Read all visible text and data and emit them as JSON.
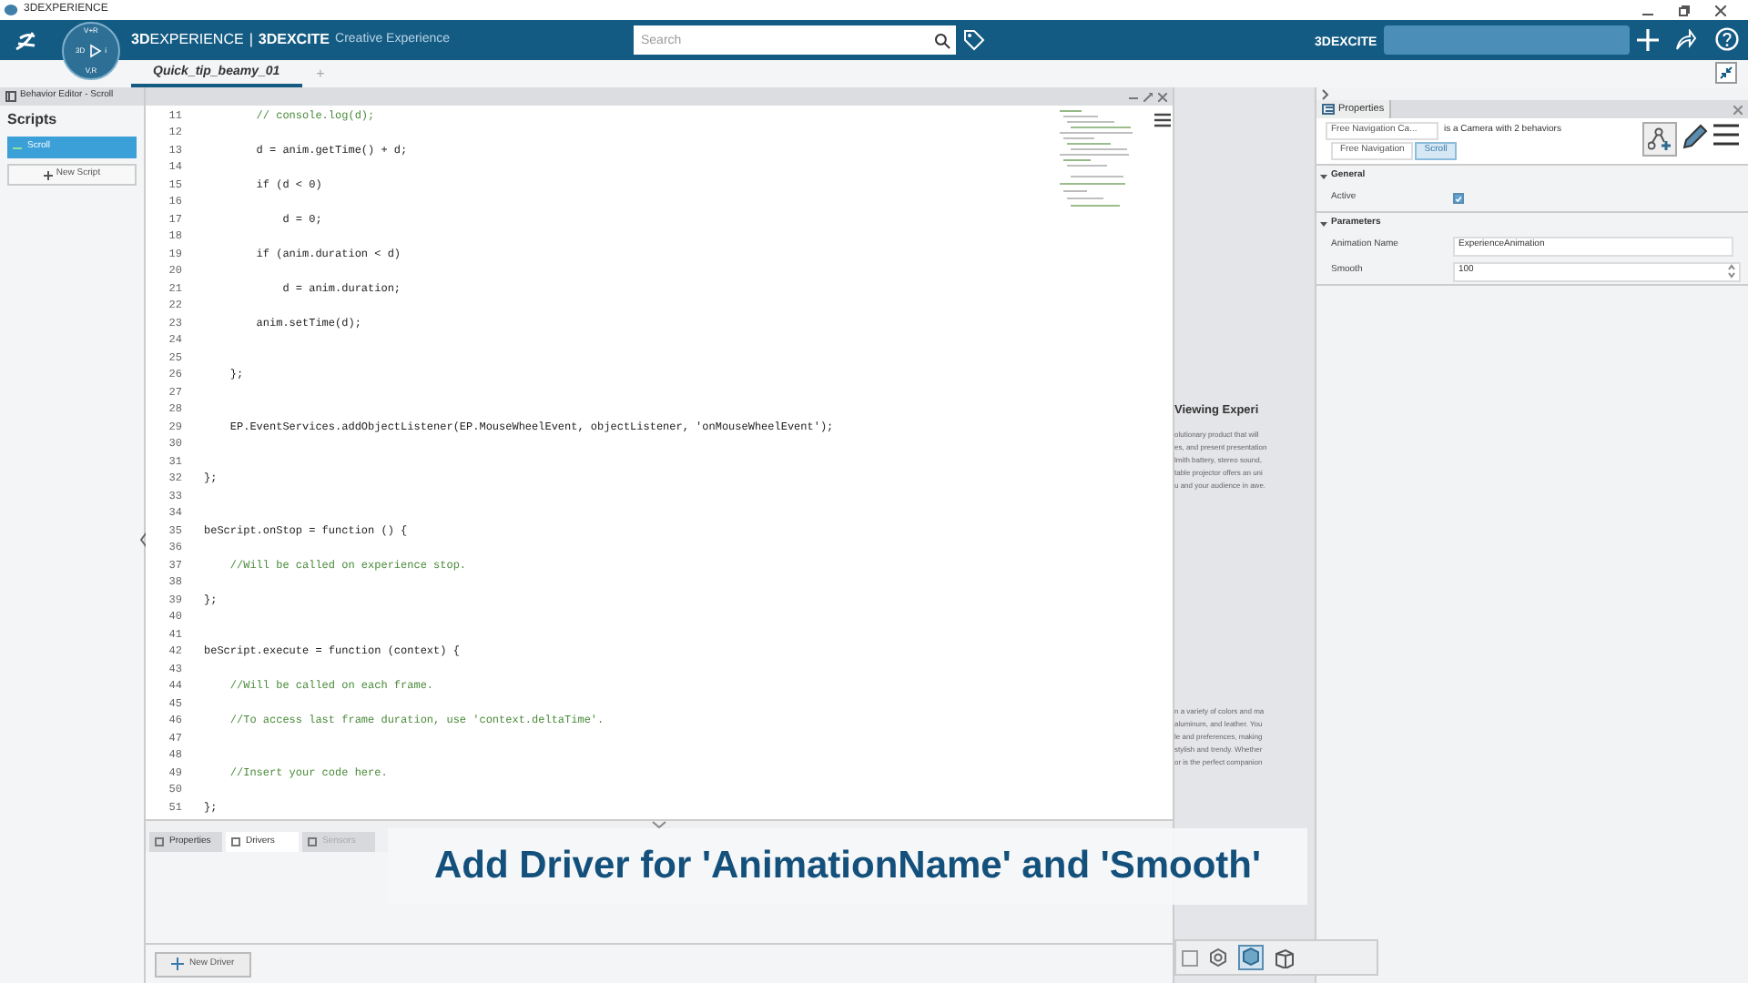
{
  "window": {
    "title": "3DEXPERIENCE"
  },
  "topbar": {
    "brand_bold": "3D",
    "brand_rest": "EXPERIENCE",
    "separator": "|",
    "product_bold": "3DEXCITE",
    "product_rest": "Creative Experience",
    "compass": {
      "top": "V+R",
      "left": "3D",
      "bottom": "V,R",
      "right": "i"
    },
    "search": {
      "placeholder": "Search"
    },
    "tenant": "3DEXCITE"
  },
  "tabs": [
    {
      "label": "Quick_tip_beamy_01",
      "selected": true
    },
    {
      "label": "+",
      "selected": false
    }
  ],
  "behavior_editor": {
    "title": "Behavior Editor - Scroll",
    "heading": "Scripts",
    "scripts": [
      {
        "label": "Scroll",
        "selected": true
      }
    ],
    "new_script": "New Script"
  },
  "code": [
    {
      "num": "11",
      "text": "        // console.log(d);",
      "kind": "comment"
    },
    {
      "num": "12"
    },
    {
      "num": "13",
      "text": "        d = anim.getTime() + d;",
      "kind": "code"
    },
    {
      "num": "14"
    },
    {
      "num": "15",
      "text": "        if (d < 0)",
      "kind": "code"
    },
    {
      "num": "16"
    },
    {
      "num": "17",
      "text": "            d = 0;",
      "kind": "code"
    },
    {
      "num": "18"
    },
    {
      "num": "19",
      "text": "        if (anim.duration < d)",
      "kind": "code"
    },
    {
      "num": "20"
    },
    {
      "num": "21",
      "text": "            d = anim.duration;",
      "kind": "code"
    },
    {
      "num": "22"
    },
    {
      "num": "23",
      "text": "        anim.setTime(d);",
      "kind": "code"
    },
    {
      "num": "24"
    },
    {
      "num": "25"
    },
    {
      "num": "26",
      "text": "    };",
      "kind": "code"
    },
    {
      "num": "27"
    },
    {
      "num": "28"
    },
    {
      "num": "29",
      "text": "    EP.EventServices.addObjectListener(EP.MouseWheelEvent, objectListener, 'onMouseWheelEvent');",
      "kind": "code"
    },
    {
      "num": "30"
    },
    {
      "num": "31"
    },
    {
      "num": "32",
      "text": "};",
      "kind": "code"
    },
    {
      "num": "33"
    },
    {
      "num": "34"
    },
    {
      "num": "35",
      "text": "beScript.onStop = function () {",
      "kind": "code"
    },
    {
      "num": "36"
    },
    {
      "num": "37",
      "text": "    //Will be called on experience stop.",
      "kind": "comment"
    },
    {
      "num": "38"
    },
    {
      "num": "39",
      "text": "};",
      "kind": "code"
    },
    {
      "num": "40"
    },
    {
      "num": "41"
    },
    {
      "num": "42",
      "text": "beScript.execute = function (context) {",
      "kind": "code"
    },
    {
      "num": "43"
    },
    {
      "num": "44",
      "text": "    //Will be called on each frame.",
      "kind": "comment"
    },
    {
      "num": "45"
    },
    {
      "num": "46",
      "text": "    //To access last frame duration, use 'context.deltaTime'.",
      "kind": "comment"
    },
    {
      "num": "47"
    },
    {
      "num": "48"
    },
    {
      "num": "49",
      "text": "    //Insert your code here.",
      "kind": "comment"
    },
    {
      "num": "50"
    },
    {
      "num": "51",
      "text": "};",
      "kind": "code"
    }
  ],
  "bottom_tabs": [
    {
      "label": "Properties",
      "selected": false,
      "disabled": false
    },
    {
      "label": "Drivers",
      "selected": true,
      "disabled": false
    },
    {
      "label": "Sensors",
      "selected": false,
      "disabled": true
    }
  ],
  "new_driver": "New Driver",
  "viewport": {
    "heading": "Viewing Experi",
    "paragraph_1": [
      "olutionary product that will",
      "es, and present presentation",
      "lmith battery, stereo sound,",
      "table projector offers an uni",
      "u and your audience in awe."
    ],
    "paragraph_2": [
      "n a variety of colors and ma",
      "aluminum, and leather. You",
      "le and preferences, making",
      "stylish and trendy. Whether",
      "or is the perfect companion"
    ]
  },
  "properties": {
    "title": "Properties",
    "object": "Free Navigation Ca...",
    "description": "is a Camera with 2 behaviors",
    "behaviors": [
      {
        "label": "Free Navigation",
        "selected": false
      },
      {
        "label": "Scroll",
        "selected": true
      }
    ],
    "sections": [
      {
        "title": "General",
        "expanded": true,
        "rows": [
          {
            "kind": "checkbox",
            "label": "Active",
            "checked": true
          }
        ]
      },
      {
        "title": "Parameters",
        "expanded": true,
        "rows": [
          {
            "kind": "text",
            "label": "Animation Name",
            "value": "ExperienceAnimation"
          },
          {
            "kind": "number",
            "label": "Smooth",
            "value": "100"
          }
        ]
      }
    ]
  },
  "caption": "Add Driver for 'AnimationName' and 'Smooth'"
}
